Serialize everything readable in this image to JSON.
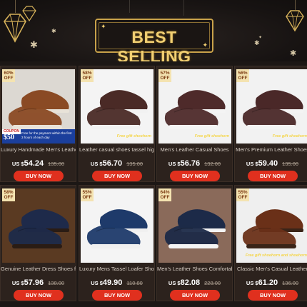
{
  "banner": {
    "title": "BEST SELLING"
  },
  "products": [
    {
      "badge_pct": "60%",
      "badge_off": "OFF",
      "name": "Luxury Handmade Men's Leather",
      "currency": "US $",
      "price": "54.24",
      "old_price": "135.00",
      "button": "BUY NOW",
      "overlay": "coupon",
      "coupon_tag": "COUPON",
      "coupon_amount": "$50",
      "coupon_text": "Free for the payment within the first 3 hours of each day",
      "upper_color": "#8a4a24",
      "sole_color": "#e8e2d8",
      "bg": "#dcd8d2"
    },
    {
      "badge_pct": "58%",
      "badge_off": "OFF",
      "name": "Leather casual shoes tassel high-",
      "currency": "US $",
      "price": "56.70",
      "old_price": "135.00",
      "button": "BUY NOW",
      "overlay": "gift",
      "gift_text": "Free gift shoehorn",
      "upper_color": "#4a2a26",
      "sole_color": "#f2f2f2",
      "bg": "#f4f4f4"
    },
    {
      "badge_pct": "57%",
      "badge_off": "OFF",
      "name": "Men's Leather Casual Shoes",
      "currency": "US $",
      "price": "56.76",
      "old_price": "132.00",
      "button": "BUY NOW",
      "overlay": "gift",
      "gift_text": "Free gift shoehorn",
      "upper_color": "#4e2a2a",
      "sole_color": "#f4f4f4",
      "bg": "#f2f2f2"
    },
    {
      "badge_pct": "56%",
      "badge_off": "OFF",
      "name": "Men's Premium Leather Shoes",
      "currency": "US $",
      "price": "59.40",
      "old_price": "135.00",
      "button": "BUY NOW",
      "overlay": "gift",
      "gift_text": "Free gift shoehorn",
      "upper_color": "#4a2828",
      "sole_color": "#f4f4f4",
      "bg": "#f2f2f2"
    },
    {
      "badge_pct": "58%",
      "badge_off": "OFF",
      "name": "Genuine Leather Dress Shoes for",
      "currency": "US $",
      "price": "57.96",
      "old_price": "138.00",
      "button": "BUY NOW",
      "overlay": "none",
      "upper_color": "#1e2a4a",
      "sole_color": "#2a1c14",
      "bg": "#5a3a22"
    },
    {
      "badge_pct": "55%",
      "badge_off": "OFF",
      "name": "Luxury Mens Tassel Loafer Shoes",
      "currency": "US $",
      "price": "49.90",
      "old_price": "110.80",
      "button": "BUY NOW",
      "overlay": "none",
      "upper_color": "#1e3a6a",
      "sole_color": "#f0f0f0",
      "bg": "#f4f4f4"
    },
    {
      "badge_pct": "64%",
      "badge_off": "OFF",
      "name": "Men's Leather Shoes Comfortable",
      "currency": "US $",
      "price": "82.08",
      "old_price": "228.00",
      "button": "BUY NOW",
      "overlay": "none",
      "upper_color": "#1c2a48",
      "sole_color": "#f4f4f4",
      "bg": "#8a6a5a"
    },
    {
      "badge_pct": "55%",
      "badge_off": "OFF",
      "name": "Classic Men's Casual Leather",
      "currency": "US $",
      "price": "61.20",
      "old_price": "136.00",
      "button": "BUY NOW",
      "overlay": "gift",
      "gift_text": "Free gift shoehorn and shoehorn",
      "upper_color": "#6a3018",
      "sole_color": "#3a2418",
      "bg": "#efefef"
    }
  ],
  "colors": {
    "accent": "#e0301e",
    "gold": "#f1cf72",
    "card_bg": "#2c221d"
  }
}
